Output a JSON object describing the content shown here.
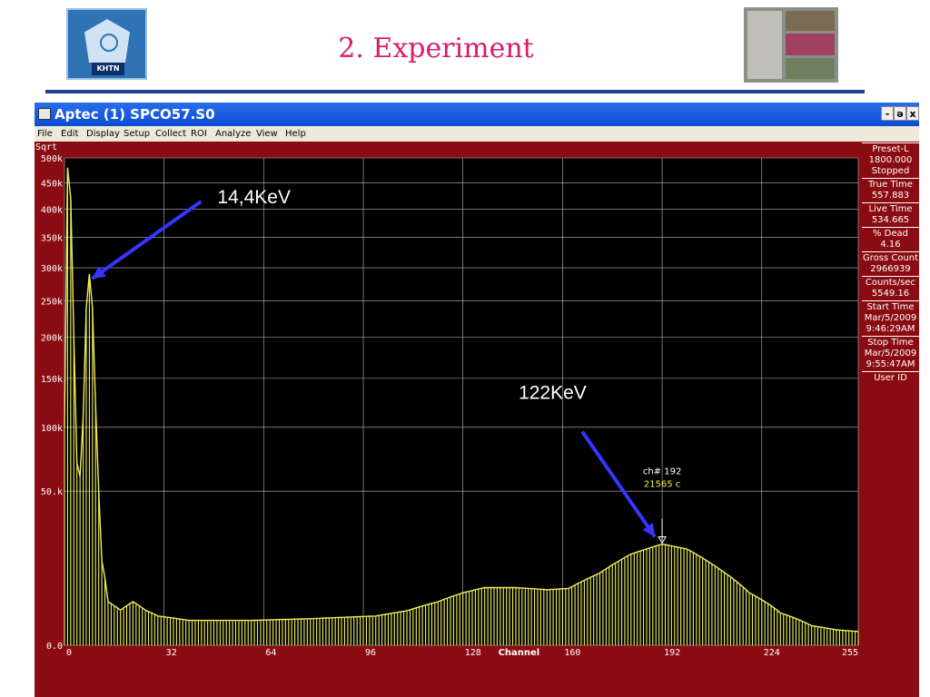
{
  "slide": {
    "title": "2. Experiment",
    "logo_text": "KHTN"
  },
  "window": {
    "title": "Aptec (1) SPCO57.S0",
    "controls": {
      "minimize": "-",
      "restore": "ə",
      "close": "x"
    },
    "menu": [
      "File",
      "Edit",
      "Display",
      "Setup",
      "Collect",
      "ROI",
      "Analyze",
      "View",
      "Help"
    ]
  },
  "status_panel": {
    "preset_label": "Preset-L",
    "preset_value": "1800.000",
    "state": "Stopped",
    "true_time_label": "True Time",
    "true_time_value": "557.883",
    "live_time_label": "Live Time",
    "live_time_value": "534.665",
    "dead_label": "% Dead",
    "dead_value": "4.16",
    "gross_label": "Gross Count",
    "gross_value": "2966939",
    "cps_label": "Counts/sec",
    "cps_value": "5549.16",
    "start_label": "Start Time",
    "start_date": "Mar/5/2009",
    "start_time": "9:46:29AM",
    "stop_label": "Stop Time",
    "stop_date": "Mar/5/2009",
    "stop_time": "9:55:47AM",
    "user_label": "User ID"
  },
  "chart_data": {
    "type": "bar",
    "scale": "sqrt",
    "ylabel": "Sqrt",
    "xlabel": "Channel",
    "xlim": [
      0,
      255
    ],
    "ylim": [
      0,
      500000
    ],
    "x_ticks": [
      0,
      32,
      64,
      96,
      128,
      160,
      192,
      224,
      255
    ],
    "y_ticks": [
      {
        "value": 500000,
        "label": "500k"
      },
      {
        "value": 450000,
        "label": "450k"
      },
      {
        "value": 400000,
        "label": "400k"
      },
      {
        "value": 350000,
        "label": "350k"
      },
      {
        "value": 300000,
        "label": "300k"
      },
      {
        "value": 250000,
        "label": "250k"
      },
      {
        "value": 200000,
        "label": "200k"
      },
      {
        "value": 150000,
        "label": "150k"
      },
      {
        "value": 100000,
        "label": "100k"
      },
      {
        "value": 50000,
        "label": "50.k"
      },
      {
        "value": 0,
        "label": "0.0"
      }
    ],
    "grid": true,
    "colors": {
      "background": "#000000",
      "bars": "#f0f05a",
      "grid": "#bbbbbb",
      "frame": "#8a0c12",
      "arrow": "#3535ff"
    },
    "profile": [
      {
        "channel": 0,
        "count": 100000
      },
      {
        "channel": 1,
        "count": 480000
      },
      {
        "channel": 2,
        "count": 420000
      },
      {
        "channel": 3,
        "count": 200000
      },
      {
        "channel": 4,
        "count": 70000
      },
      {
        "channel": 5,
        "count": 60000
      },
      {
        "channel": 6,
        "count": 110000
      },
      {
        "channel": 7,
        "count": 240000
      },
      {
        "channel": 8,
        "count": 290000
      },
      {
        "channel": 9,
        "count": 240000
      },
      {
        "channel": 10,
        "count": 120000
      },
      {
        "channel": 11,
        "count": 50000
      },
      {
        "channel": 12,
        "count": 15000
      },
      {
        "channel": 14,
        "count": 4000
      },
      {
        "channel": 18,
        "count": 2600
      },
      {
        "channel": 22,
        "count": 4000
      },
      {
        "channel": 26,
        "count": 2600
      },
      {
        "channel": 30,
        "count": 1800
      },
      {
        "channel": 40,
        "count": 1300
      },
      {
        "channel": 60,
        "count": 1300
      },
      {
        "channel": 80,
        "count": 1500
      },
      {
        "channel": 100,
        "count": 1800
      },
      {
        "channel": 110,
        "count": 2500
      },
      {
        "channel": 120,
        "count": 4000
      },
      {
        "channel": 128,
        "count": 5800
      },
      {
        "channel": 135,
        "count": 7000
      },
      {
        "channel": 145,
        "count": 7000
      },
      {
        "channel": 155,
        "count": 6500
      },
      {
        "channel": 162,
        "count": 6800
      },
      {
        "channel": 172,
        "count": 11000
      },
      {
        "channel": 182,
        "count": 17500
      },
      {
        "channel": 192,
        "count": 21565
      },
      {
        "channel": 200,
        "count": 19500
      },
      {
        "channel": 210,
        "count": 12500
      },
      {
        "channel": 220,
        "count": 5800
      },
      {
        "channel": 230,
        "count": 2200
      },
      {
        "channel": 240,
        "count": 800
      },
      {
        "channel": 248,
        "count": 500
      },
      {
        "channel": 255,
        "count": 400
      }
    ],
    "cursor": {
      "channel": 192,
      "count": 21565,
      "label_channel": "ch# 192",
      "label_count": "21565 c"
    },
    "annotations": [
      {
        "text": "14,4KeV",
        "channel": 8,
        "count": 290000
      },
      {
        "text": "122KeV",
        "channel": 192,
        "count": 21565
      }
    ]
  }
}
